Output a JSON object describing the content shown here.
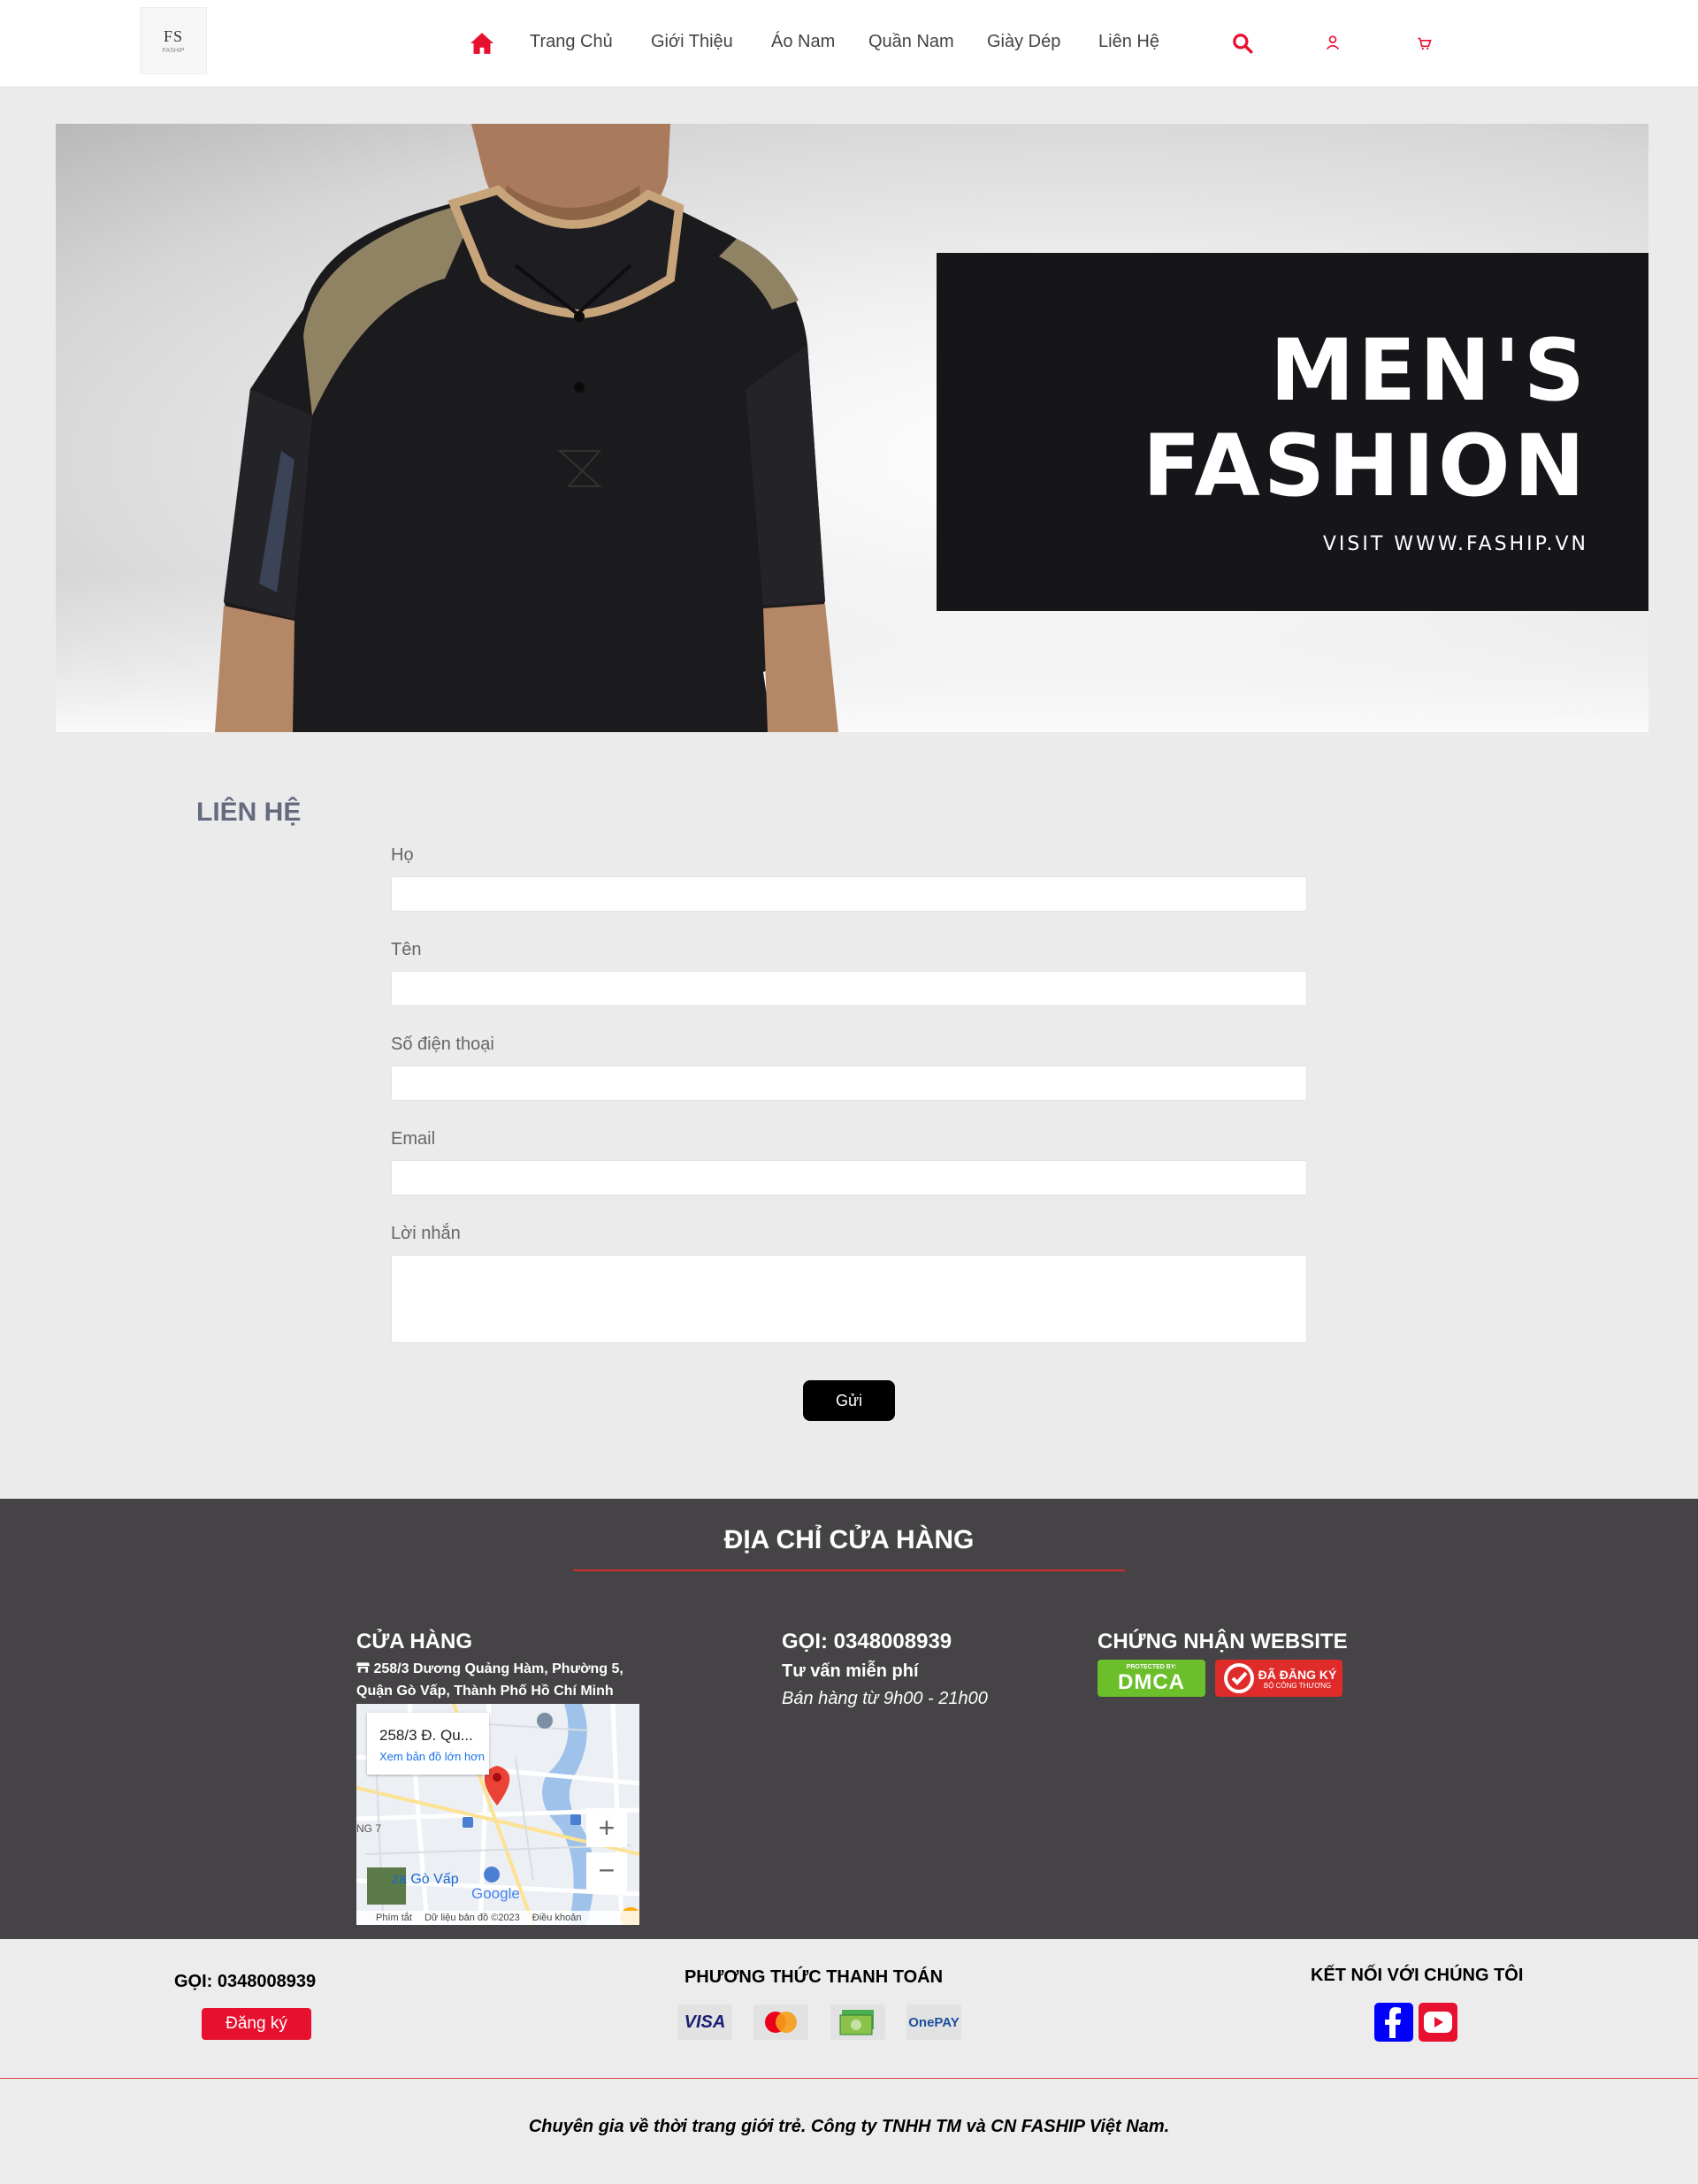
{
  "header": {
    "logo_main": "FS",
    "logo_sub": "FASHIP",
    "nav": [
      "Trang Chủ",
      "Giới Thiệu",
      "Áo Nam",
      "Quần Nam",
      "Giày Dép",
      "Liên Hệ"
    ]
  },
  "banner": {
    "line1": "MEN'S",
    "line2": "FASHION",
    "line3": "VISIT WWW.FASHIP.VN"
  },
  "contact": {
    "title": "LIÊN HỆ",
    "fields": [
      {
        "label": "Họ",
        "value": ""
      },
      {
        "label": "Tên",
        "value": ""
      },
      {
        "label": "Số điện thoại",
        "value": ""
      },
      {
        "label": "Email",
        "value": ""
      },
      {
        "label": "Lời nhắn",
        "value": ""
      }
    ],
    "submit": "Gửi"
  },
  "store_footer": {
    "heading": "ĐỊA CHỈ CỬA HÀNG",
    "store_title": "CỬA HÀNG",
    "address": "258/3 Dương Quảng Hàm, Phường 5, Quận Gò Vấp, Thành Phố Hồ Chí Minh",
    "map": {
      "place": "258/3 Đ. Qu...",
      "link": "Xem bản đồ lớn hơn",
      "area": "za Gò Vấp",
      "street": "NG 7",
      "brand": "Google",
      "shortcuts": "Phím tắt",
      "data": "Dữ liệu bản đồ ©2023",
      "terms": "Điều khoản",
      "zoom_in": "+",
      "zoom_out": "−"
    },
    "call": "GỌI: 0348008939",
    "consult": "Tư vấn miễn phí",
    "hours": "Bán hàng từ 9h00 - 21h00",
    "cert_title": "CHỨNG NHẬN WEBSITE",
    "dmca_top": "PROTECTED BY:",
    "dmca": "DMCA",
    "registered": "ĐÃ ĐĂNG KÝ",
    "registered_sub": "BỘ CÔNG THƯƠNG"
  },
  "bottom_footer": {
    "call": "GỌI: 0348008939",
    "register": "Đăng ký",
    "payment_title": "PHƯƠNG THỨC THANH TOÁN",
    "payments": [
      "VISA",
      "Mastercard",
      "Cash",
      "OnePAY"
    ],
    "visa": "VISA",
    "onepay": "OnePAY",
    "social_title": "KẾT NỐI VỚI CHÚNG TÔI",
    "socials": [
      "facebook",
      "youtube"
    ],
    "slogan": "Chuyên gia về thời trang giới trẻ. Công ty TNHH TM và CN FASHIP Việt Nam."
  },
  "colors": {
    "accent_red": "#e8102f",
    "footer_dark": "#454345",
    "banner_box": "#16161a",
    "facebook": "#0000ff",
    "youtube": "#e8102f"
  }
}
